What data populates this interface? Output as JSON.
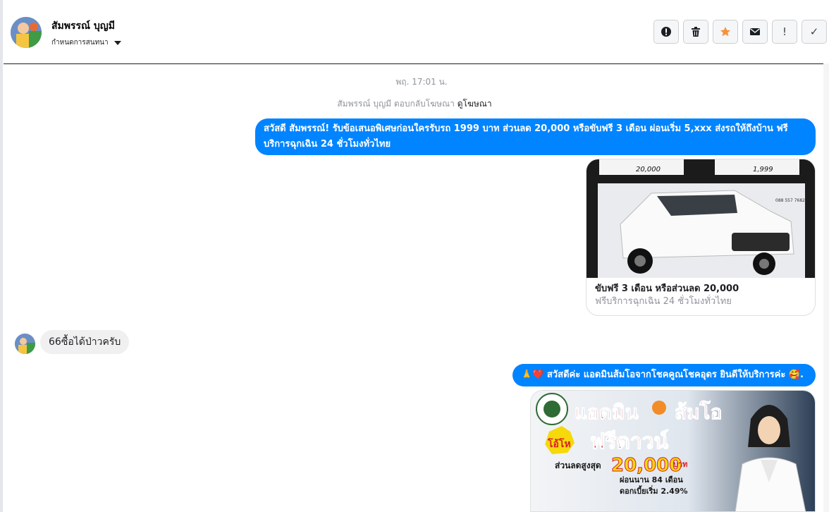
{
  "header": {
    "name": "สัมพรรณ์ บุญมี",
    "subtitle": "กำหนดการสนทนา",
    "actions": [
      {
        "name": "report-button",
        "icon": "alert-circle-icon"
      },
      {
        "name": "delete-button",
        "icon": "trash-icon"
      },
      {
        "name": "star-button",
        "icon": "star-icon"
      },
      {
        "name": "mark-unread-button",
        "icon": "envelope-icon"
      },
      {
        "name": "priority-button",
        "icon": "exclamation-icon",
        "glyph": "!"
      },
      {
        "name": "done-button",
        "icon": "check-icon",
        "glyph": "✓"
      }
    ],
    "star_color": "#f7923a"
  },
  "thread": {
    "timestamp": "พฤ. 17:01 น.",
    "reply_note": "สัมพรรณ์ บุญมี ตอบกลับโฆษณา",
    "reply_link": "ดูโฆษณา",
    "outgoing_1": "สวัสดี สัมพรรณ์! รับข้อเสนอพิเศษก่อนใครรับรถ 1999 บาท ส่วนลด 20,000 หรือขับฟรี 3 เดือน ผ่อนเริ่ม 5,xxx ส่งรถให้ถึงบ้าน ฟรีบริการฉุกเฉิน 24 ชั่วโมงทั่วไทย",
    "card": {
      "badge_left": "20,000",
      "badge_right": "1,999",
      "phone": "088 557 7682",
      "title": "ขับฟรี 3 เดือน หรือส่วนลด 20,000",
      "subtitle": "ฟรีบริการฉุกเฉิน 24 ชั่วโมงทั่วไทย"
    },
    "incoming_1": "66ซื้อได้ป่าวครับ",
    "outgoing_2_prefix": "🙏❤️",
    "outgoing_2": "สวัสดีค่ะ แอดมินส้มโอจากโชคคูณโชคอุดร ยินดีให้บริการค่ะ",
    "outgoing_2_suffix": "🥰.",
    "promo": {
      "headline_1": "แอดมิน",
      "headline_2": "ส้มโอ",
      "tag": "โอ้โห",
      "offer": "ฟรีดาวน์",
      "discount_label": "ส่วนลดสูงสุด",
      "discount_value": "20,000",
      "currency": "บาท",
      "installment": "ผ่อนนาน 84 เดือน",
      "interest": "ดอกเบี้ยเริ่ม 2.49%"
    }
  },
  "colors": {
    "accent": "#0084ff",
    "incoming_bg": "#f1f0f0",
    "meta_text": "#90949c"
  }
}
